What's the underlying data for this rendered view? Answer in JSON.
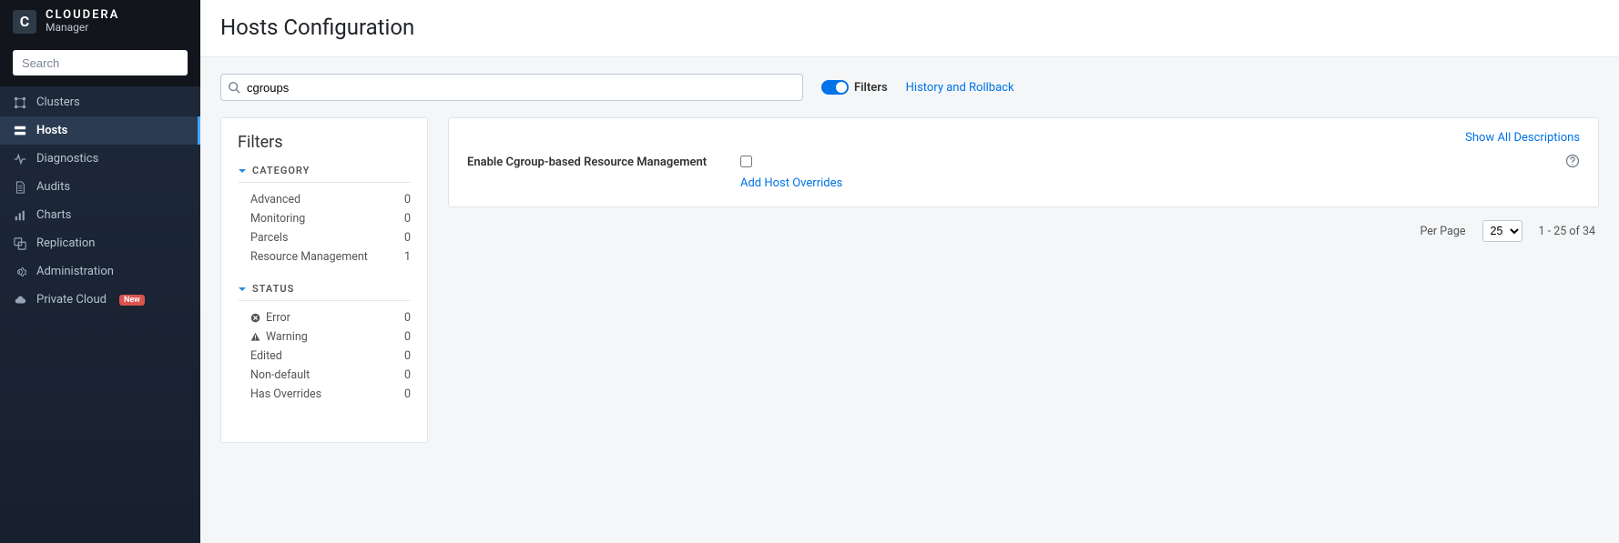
{
  "brand": {
    "name": "CLOUDERA",
    "sub": "Manager",
    "logoLetter": "C"
  },
  "sidebar": {
    "searchPlaceholder": "Search",
    "items": [
      {
        "label": "Clusters",
        "icon": "clusters-icon"
      },
      {
        "label": "Hosts",
        "icon": "hosts-icon",
        "active": true
      },
      {
        "label": "Diagnostics",
        "icon": "diagnostics-icon"
      },
      {
        "label": "Audits",
        "icon": "audits-icon"
      },
      {
        "label": "Charts",
        "icon": "charts-icon"
      },
      {
        "label": "Replication",
        "icon": "replication-icon"
      },
      {
        "label": "Administration",
        "icon": "administration-icon"
      },
      {
        "label": "Private Cloud",
        "icon": "private-cloud-icon",
        "badge": "New"
      }
    ]
  },
  "header": {
    "title": "Hosts Configuration"
  },
  "toolbar": {
    "searchValue": "cgroups",
    "filtersToggleLabel": "Filters",
    "historyLink": "History and Rollback"
  },
  "filters": {
    "title": "Filters",
    "sections": [
      {
        "name": "CATEGORY",
        "items": [
          {
            "label": "Advanced",
            "count": 0
          },
          {
            "label": "Monitoring",
            "count": 0
          },
          {
            "label": "Parcels",
            "count": 0
          },
          {
            "label": "Resource Management",
            "count": 1
          }
        ]
      },
      {
        "name": "STATUS",
        "items": [
          {
            "label": "Error",
            "count": 0,
            "icon": "error-icon"
          },
          {
            "label": "Warning",
            "count": 0,
            "icon": "warning-icon"
          },
          {
            "label": "Edited",
            "count": 0
          },
          {
            "label": "Non-default",
            "count": 0
          },
          {
            "label": "Has Overrides",
            "count": 0
          }
        ]
      }
    ]
  },
  "config": {
    "showAll": "Show All Descriptions",
    "propertyLabel": "Enable Cgroup-based Resource Management",
    "addOverrides": "Add Host Overrides"
  },
  "pager": {
    "perPageLabel": "Per Page",
    "perPageValue": "25",
    "rangeText": "1 - 25 of 34"
  }
}
